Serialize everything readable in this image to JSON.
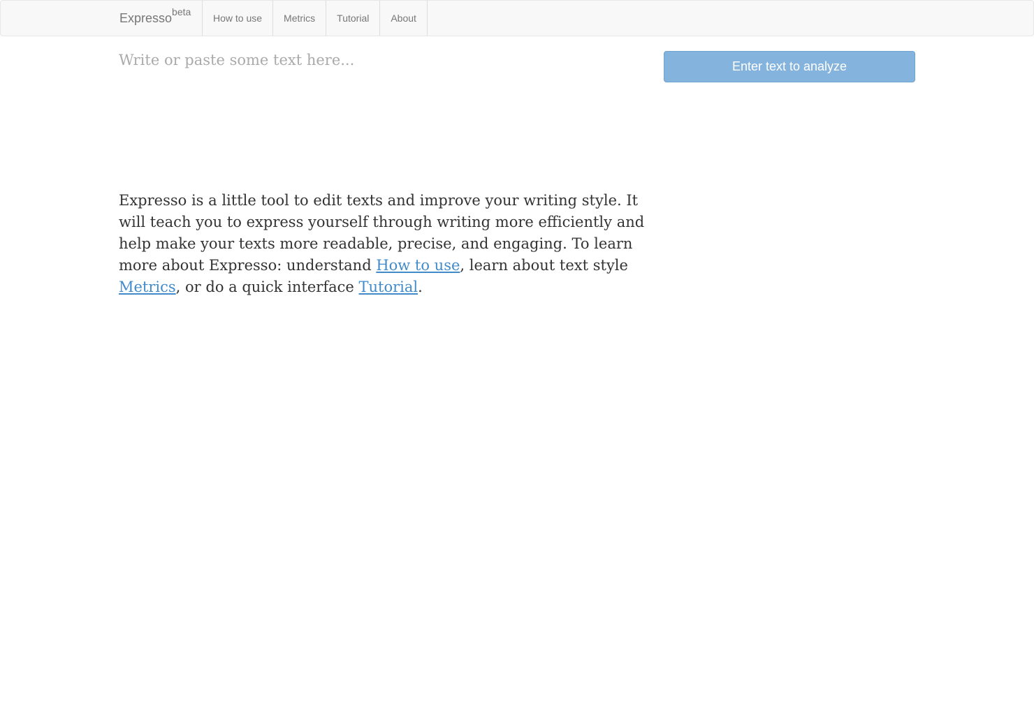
{
  "navbar": {
    "brand": "Expresso",
    "brand_badge": "beta",
    "items": [
      {
        "label": "How to use"
      },
      {
        "label": "Metrics"
      },
      {
        "label": "Tutorial"
      },
      {
        "label": "About"
      }
    ]
  },
  "editor": {
    "placeholder": "Write or paste some text here...",
    "value": ""
  },
  "analyze_button": {
    "label": "Enter text to analyze",
    "color": "#84b4dd"
  },
  "intro": {
    "text_1": "Expresso is a little tool to edit texts and improve your writing style. It will teach you to express yourself through writing more efficiently and help make your texts more readable, precise, and engaging. To learn more about Expresso: understand ",
    "link_how_to_use": "How to use",
    "text_2": ", learn about text style ",
    "link_metrics": "Metrics",
    "text_3": ", or do a quick interface ",
    "link_tutorial": "Tutorial",
    "text_4": "."
  },
  "colors": {
    "navbar_bg": "#f8f8f8",
    "link": "#428bca",
    "body_text": "#333333"
  }
}
